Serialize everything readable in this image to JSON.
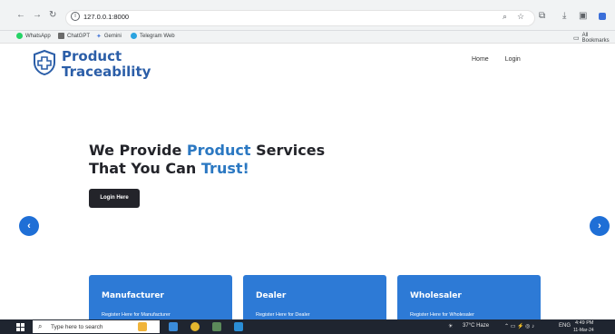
{
  "browser": {
    "url": "127.0.0.1:8000",
    "nav_back": "←",
    "nav_forward": "→",
    "nav_reload": "↻",
    "bookmarks": [
      {
        "label": "WhatsApp",
        "color": "#25d366"
      },
      {
        "label": "ChatGPT",
        "color": "#6b6b6b"
      },
      {
        "label": "Gemini",
        "color": "#4a7bd9"
      },
      {
        "label": "Telegram Web",
        "color": "#2aa3e0"
      }
    ],
    "all_bookmarks": "All Bookmarks"
  },
  "site": {
    "brand_line1": "Product",
    "brand_line2": "Traceability",
    "nav_home": "Home",
    "nav_login": "Login",
    "hero_line1_a": "We Provide ",
    "hero_line1_b": "Product",
    "hero_line1_c": " Services",
    "hero_line2_a": "That You Can ",
    "hero_line2_b": "Trust!",
    "login_button": "Login Here",
    "prev_icon": "‹",
    "next_icon": "›",
    "cards": [
      {
        "title": "Manufacturer",
        "subtitle": "Register Here for Manufacturer"
      },
      {
        "title": "Dealer",
        "subtitle": "Register Here for Dealer"
      },
      {
        "title": "Wholesaler",
        "subtitle": "Register Here for Wholesaler"
      }
    ]
  },
  "taskbar": {
    "search_placeholder": "Type here to search",
    "weather": "37°C Haze",
    "lang": "ENG",
    "time": "4:49 PM",
    "date": "11-Mar-24"
  },
  "colors": {
    "brand": "#2b5ea8",
    "accent": "#2b78c2",
    "card": "#2d7ad6",
    "dark_button": "#23242a"
  }
}
